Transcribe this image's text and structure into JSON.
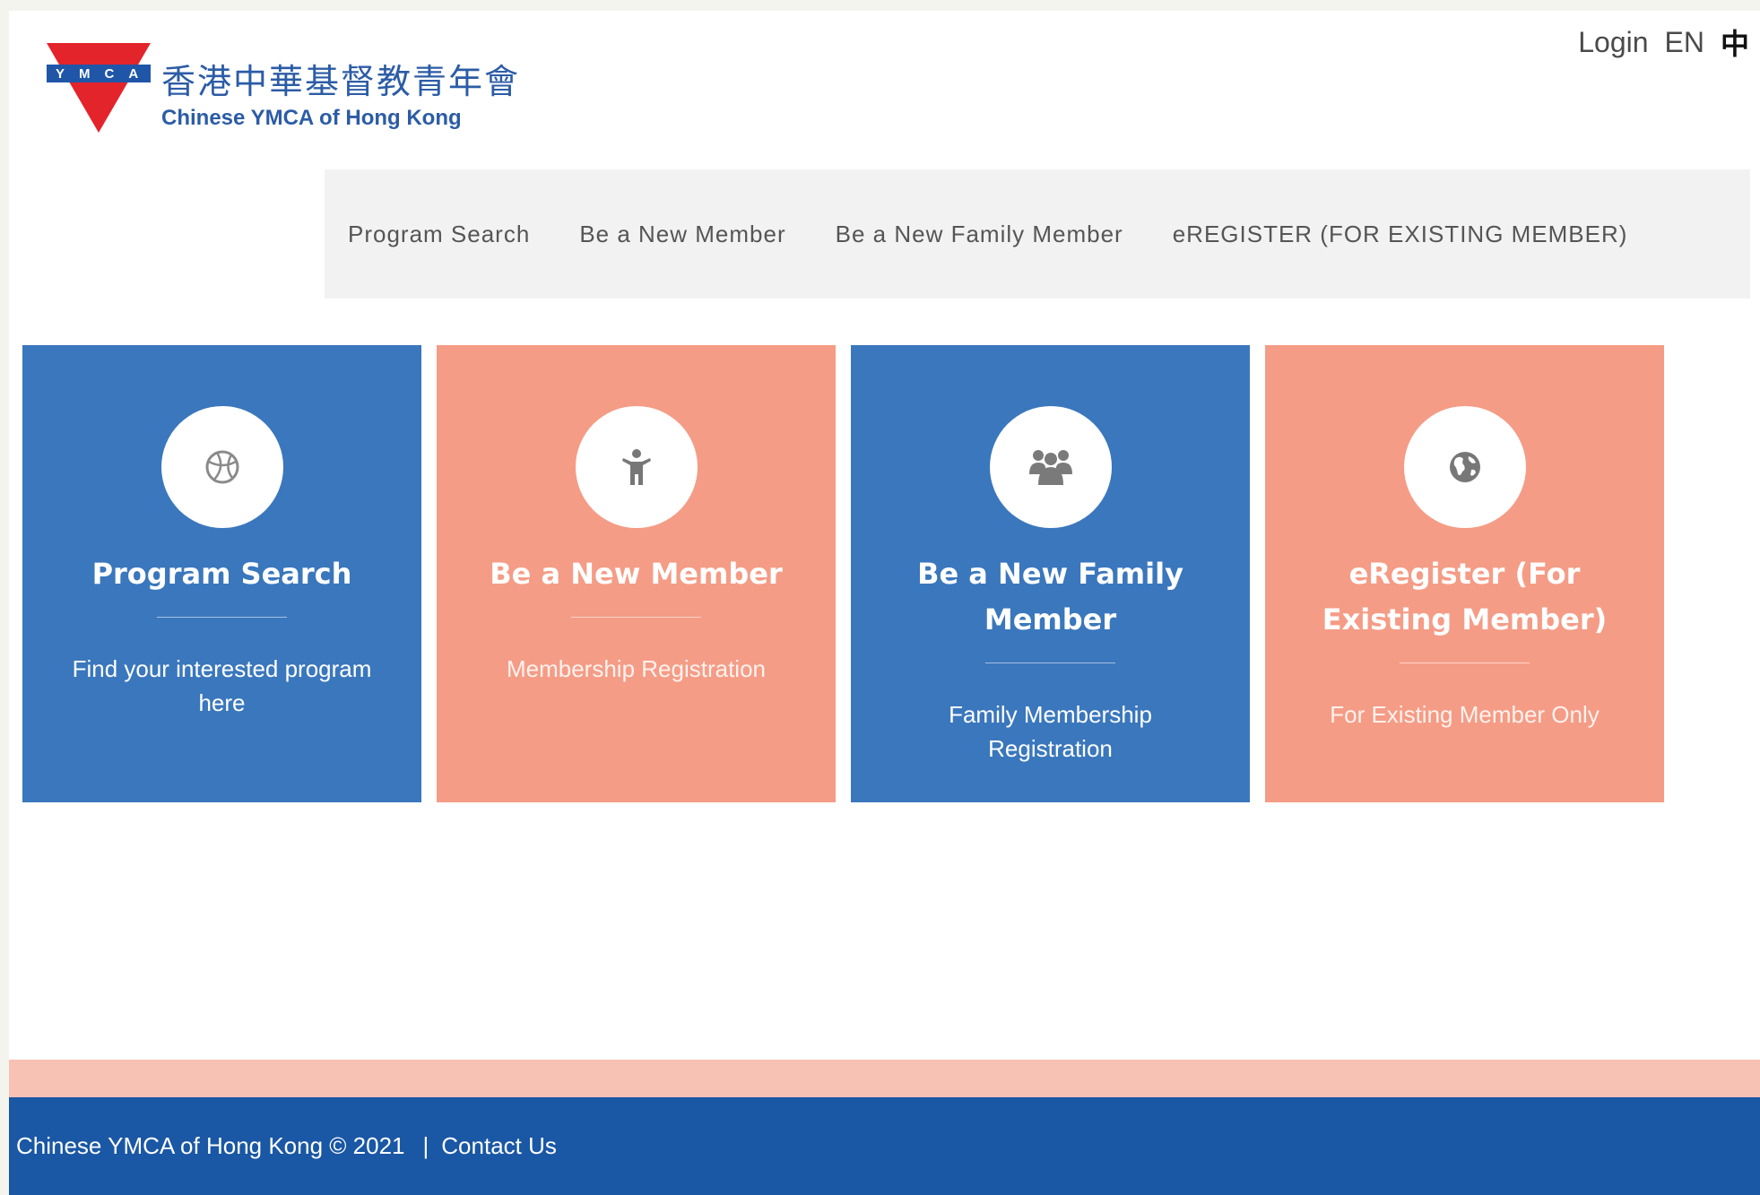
{
  "header": {
    "logo_letters": "YMCA",
    "logo_name_zh": "香港中華基督教青年會",
    "logo_name_en": "Chinese YMCA of Hong Kong",
    "login_label": "Login",
    "lang_en": "EN",
    "lang_zh": "中"
  },
  "nav": {
    "items": [
      {
        "label": "Program Search"
      },
      {
        "label": "Be a New Member"
      },
      {
        "label": "Be a New Family Member"
      },
      {
        "label": "eREGISTER (FOR EXISTING MEMBER)"
      }
    ]
  },
  "tiles": [
    {
      "title": "Program Search",
      "subtitle": "Find your interested program here",
      "icon": "basketball-icon",
      "color": "#3a77bd"
    },
    {
      "title": "Be a New Member",
      "subtitle": "Membership Registration",
      "icon": "person-icon",
      "color": "#f59c86"
    },
    {
      "title": "Be a New Family Member",
      "subtitle": "Family Membership Registration",
      "icon": "group-icon",
      "color": "#3a77bd"
    },
    {
      "title": "eRegister (For Existing Member)",
      "subtitle": "For Existing Member Only",
      "icon": "globe-icon",
      "color": "#f59c86"
    }
  ],
  "footer": {
    "copyright": "Chinese YMCA of Hong Kong © 2021",
    "separator": "|",
    "contact_label": "Contact Us"
  },
  "colors": {
    "brand_blue": "#1a57a5",
    "tile_blue": "#3a77bd",
    "tile_salmon": "#f59c86",
    "footer_band": "#f7c1b4",
    "logo_red": "#e3242b"
  }
}
